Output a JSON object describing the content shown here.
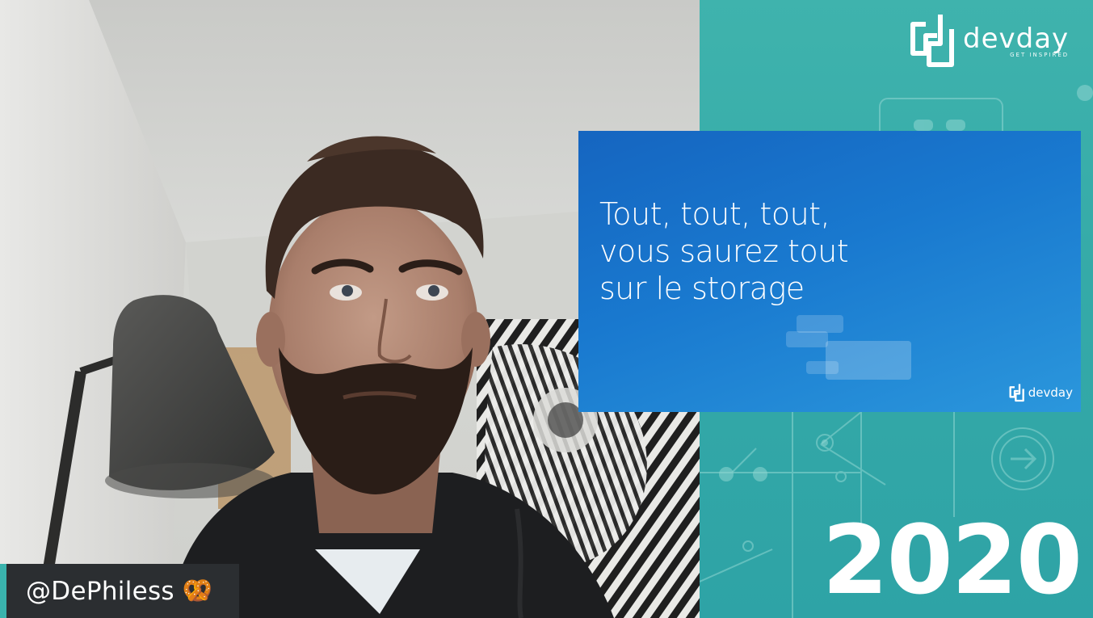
{
  "brand": {
    "logo_name": "devday",
    "logo_tagline": "GET INSPIRED",
    "year": "2020",
    "accent_color": "#3ab3ad"
  },
  "slide": {
    "title_lines": [
      "Tout, tout, tout,",
      "vous saurez tout",
      "sur le storage"
    ],
    "logo_name": "devday",
    "background_color": "#1979cf"
  },
  "speaker": {
    "handle": "@DePhiless",
    "emoji": "🥨"
  }
}
